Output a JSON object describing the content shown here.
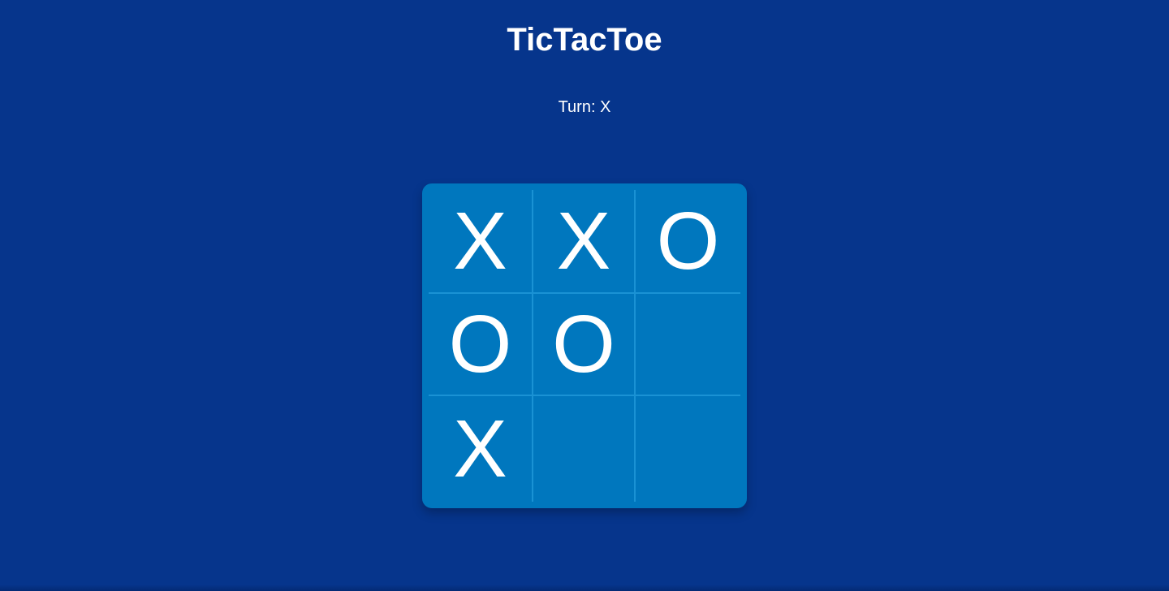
{
  "game": {
    "title": "TicTacToe",
    "turn_text": "Turn: X",
    "board": [
      [
        "X",
        "X",
        "O"
      ],
      [
        "O",
        "O",
        ""
      ],
      [
        "X",
        "",
        ""
      ]
    ]
  },
  "colors": {
    "background": "#06358c",
    "board": "#0077be",
    "grid_line": "#1a92d4",
    "text": "#ffffff"
  }
}
